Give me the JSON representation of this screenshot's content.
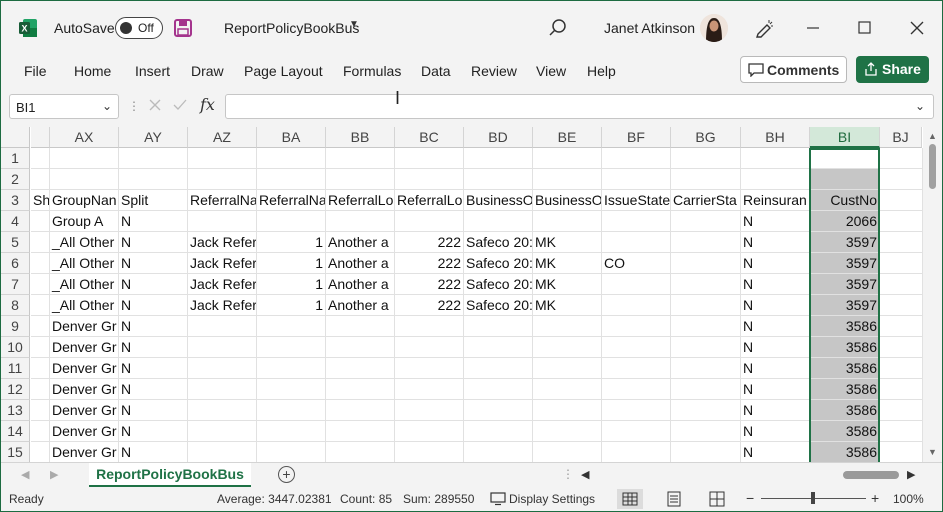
{
  "titlebar": {
    "autosave_label": "AutoSave",
    "autosave_state": "Off",
    "doc_title": "ReportPolicyBookBus",
    "user_name": "Janet Atkinson"
  },
  "menu": [
    "File",
    "Home",
    "Insert",
    "Draw",
    "Page Layout",
    "Formulas",
    "Data",
    "Review",
    "View",
    "Help"
  ],
  "actions": {
    "comments": "Comments",
    "share": "Share"
  },
  "formula_bar": {
    "name_box": "BI1",
    "fx_label": "fx",
    "value": ""
  },
  "columns": [
    {
      "label": "",
      "w": 19
    },
    {
      "label": "AX"
    },
    {
      "label": "AY"
    },
    {
      "label": "AZ"
    },
    {
      "label": "BA"
    },
    {
      "label": "BB"
    },
    {
      "label": "BC"
    },
    {
      "label": "BD"
    },
    {
      "label": "BE"
    },
    {
      "label": "BF"
    },
    {
      "label": "BG"
    },
    {
      "label": "BH"
    },
    {
      "label": "BI",
      "selected": true
    },
    {
      "label": "BJ"
    }
  ],
  "rows": [
    {
      "n": "1",
      "cells": [
        "",
        "",
        "",
        "",
        "",
        "",
        "",
        "",
        "",
        "",
        "",
        "",
        ""
      ]
    },
    {
      "n": "2",
      "cells": [
        "",
        "",
        "",
        "",
        "",
        "",
        "",
        "",
        "",
        "",
        "",
        "",
        ""
      ]
    },
    {
      "n": "3",
      "cells": [
        "Sho",
        "GroupNan",
        "Split",
        "ReferralNa",
        "ReferralNa",
        "ReferralLo",
        "ReferralLo",
        "BusinessO",
        "BusinessO",
        "IssueState",
        "CarrierSta",
        "Reinsuran",
        "CustNo"
      ]
    },
    {
      "n": "4",
      "cells": [
        "",
        "Group A",
        "N",
        "",
        "",
        "",
        "",
        "",
        "",
        "",
        "",
        "N",
        "2066"
      ]
    },
    {
      "n": "5",
      "cells": [
        "",
        "_All Other",
        "N",
        "Jack Refer",
        "1",
        "Another a",
        "222",
        "Safeco 20:",
        "MK",
        "",
        "",
        "N",
        "3597"
      ]
    },
    {
      "n": "6",
      "cells": [
        "",
        "_All Other",
        "N",
        "Jack Refer",
        "1",
        "Another a",
        "222",
        "Safeco 20:",
        "MK",
        "CO",
        "",
        "N",
        "3597"
      ]
    },
    {
      "n": "7",
      "cells": [
        "",
        "_All Other",
        "N",
        "Jack Refer",
        "1",
        "Another a",
        "222",
        "Safeco 20:",
        "MK",
        "",
        "",
        "N",
        "3597"
      ]
    },
    {
      "n": "8",
      "cells": [
        "",
        "_All Other",
        "N",
        "Jack Refer",
        "1",
        "Another a",
        "222",
        "Safeco 20:",
        "MK",
        "",
        "",
        "N",
        "3597"
      ]
    },
    {
      "n": "9",
      "cells": [
        "",
        "Denver Gr",
        "N",
        "",
        "",
        "",
        "",
        "",
        "",
        "",
        "",
        "N",
        "3586"
      ]
    },
    {
      "n": "10",
      "cells": [
        "",
        "Denver Gr",
        "N",
        "",
        "",
        "",
        "",
        "",
        "",
        "",
        "",
        "N",
        "3586"
      ]
    },
    {
      "n": "11",
      "cells": [
        "",
        "Denver Gr",
        "N",
        "",
        "",
        "",
        "",
        "",
        "",
        "",
        "",
        "N",
        "3586"
      ]
    },
    {
      "n": "12",
      "cells": [
        "",
        "Denver Gr",
        "N",
        "",
        "",
        "",
        "",
        "",
        "",
        "",
        "",
        "N",
        "3586"
      ]
    },
    {
      "n": "13",
      "cells": [
        "",
        "Denver Gr",
        "N",
        "",
        "",
        "",
        "",
        "",
        "",
        "",
        "",
        "N",
        "3586"
      ]
    },
    {
      "n": "14",
      "cells": [
        "",
        "Denver Gr",
        "N",
        "",
        "",
        "",
        "",
        "",
        "",
        "",
        "",
        "N",
        "3586"
      ]
    },
    {
      "n": "15",
      "cells": [
        "",
        "Denver Gr",
        "N",
        "",
        "",
        "",
        "",
        "",
        "",
        "",
        "",
        "N",
        "3586"
      ]
    }
  ],
  "sheet_tab": "ReportPolicyBookBus",
  "status": {
    "ready": "Ready",
    "average": "Average: 3447.02381",
    "count": "Count: 85",
    "sum": "Sum: 289550",
    "display_settings": "Display Settings",
    "zoom": "100%"
  },
  "colors": {
    "accent": "#1f7246",
    "selection_fill": "#c6c6c6"
  }
}
